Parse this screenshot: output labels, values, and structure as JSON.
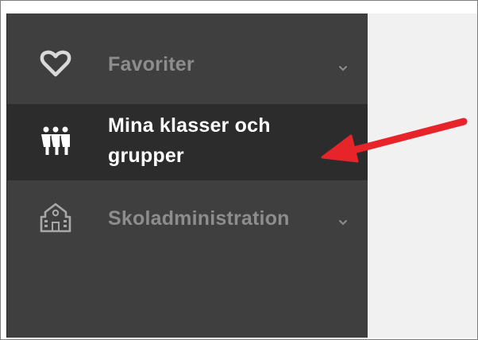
{
  "sidebar": {
    "items": [
      {
        "label": "Favoriter",
        "icon": "heart-icon",
        "expandable": true
      },
      {
        "label_line1": "Mina klasser och",
        "label_line2": "grupper",
        "icon": "group-people-icon",
        "active": true
      },
      {
        "label": "Skoladministration",
        "icon": "school-building-icon",
        "expandable": true
      }
    ]
  },
  "annotation": {
    "icon": "red-arrow-icon",
    "color": "#e8242b"
  },
  "colors": {
    "sidebar_bg": "#3f3f3f",
    "active_bg": "#2c2c2c",
    "inactive_text": "#8d8d8d",
    "active_text": "#ffffff",
    "content_bg": "#f1f1f1"
  }
}
